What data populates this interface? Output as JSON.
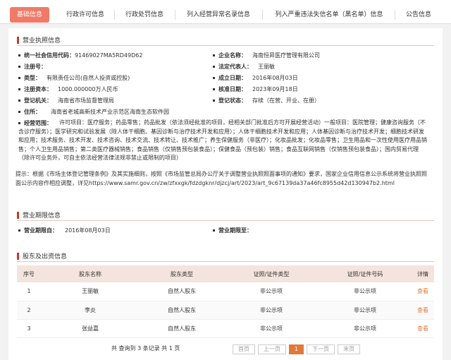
{
  "tabs": [
    "基础信息",
    "行政许可信息",
    "行政处罚信息",
    "列入经营异常名录信息",
    "列入严重违法失信名单（黑名单）信息",
    "公告信息"
  ],
  "license_section": {
    "title": "营业执照信息",
    "credit_code_label": "统一社会信用代码：",
    "credit_code": "91469027MA5RD49D62",
    "company_name_label": "企业名称：",
    "company_name": "海南恒昇医疗管理有限公司",
    "reg_no_label": "注册号：",
    "reg_no": "",
    "legal_rep_label": "法定代表人：",
    "legal_rep": "王丽敏",
    "type_label": "类型：",
    "type": "有限责任公司(自然人投资或控股)",
    "founded_label": "成立日期：",
    "founded": "2016年08月03日",
    "capital_label": "注册资本：",
    "capital": "1000.000000万人民币",
    "approved_label": "核准日期：",
    "approved": "2023年09月18日",
    "authority_label": "登记机关：",
    "authority": "海南省市场监督管理局",
    "status_label": "登记状态：",
    "status": "存续（在营、开业、在册）",
    "address_label": "住所：",
    "address": "海南省老城高新技术产业示范区海南生态软件园",
    "scope_label": "经营范围：",
    "scope": "许可项目：医疗服务；药品零售；药品批发（依法须经批准的项目，经相关部门批准后方可开展经营活动）一般项目：医院管理；健康咨询服务（不含诊疗服务）；医学研究和试验发展（除人体干细胞、基因诊断与治疗技术开发和应用）；人体干细胞技术开发和应用；人体基因诊断与治疗技术开发；细胞技术研发和应用；技术服务、技术开发、技术咨询、技术交流、技术转让、技术推广；养生保健服务（非医疗）；化妆品批发；化妆品零售；卫生用品和一次性使用医疗用品销售；个人卫生用品销售；第二类医疗器械销售；食品销售（仅销售预包装食品）；保健食品（预包装）销售；食品互联网销售（仅销售预包装食品）；国内贸易代理（除许可业务外，可自主依法经营法律法规非禁止或限制的项目）",
    "notice": "提示：根据《市场主体登记管理条例》及其实施细则，按照《市场监管总局办公厅关于调整营业执照照面事项的通知》要求，国家企业信用信息公示系统将营业执照照面公示内容作相应调整，详见https://www.samr.gov.cn/zw/zfxxgk/fdzdgknr/djzcj/art/2023/art_9c67139da37a46fc8955d42d130947b2.html"
  },
  "term_section": {
    "title": "营业期限信息",
    "from_label": "营业期限自：",
    "from": "2016年08月03日",
    "to_label": "营业期限至：",
    "to": ""
  },
  "share_section": {
    "title": "股东及出资信息",
    "headers": [
      "序号",
      "股东名称",
      "股东类型",
      "证照/证件类型",
      "证照/证件号码",
      "详情"
    ],
    "rows": [
      [
        "1",
        "王丽敏",
        "自然人股东",
        "非公示项",
        "非公示项",
        "查看"
      ],
      [
        "2",
        "李炎",
        "自然人股东",
        "非公示项",
        "非公示项",
        "查看"
      ],
      [
        "3",
        "张益嘉",
        "自然人股东",
        "非公示项",
        "非公示项",
        "查看"
      ]
    ],
    "pager_text": "共 查询到 3 条记录 共 1 页",
    "pager": {
      "first": "首页",
      "prev": "上一页",
      "page": "1",
      "next": "下一页",
      "last": "末页"
    }
  },
  "colors": {
    "accent": "#f07a67",
    "link": "#e07a3a",
    "section_bar": "#c0392b"
  }
}
